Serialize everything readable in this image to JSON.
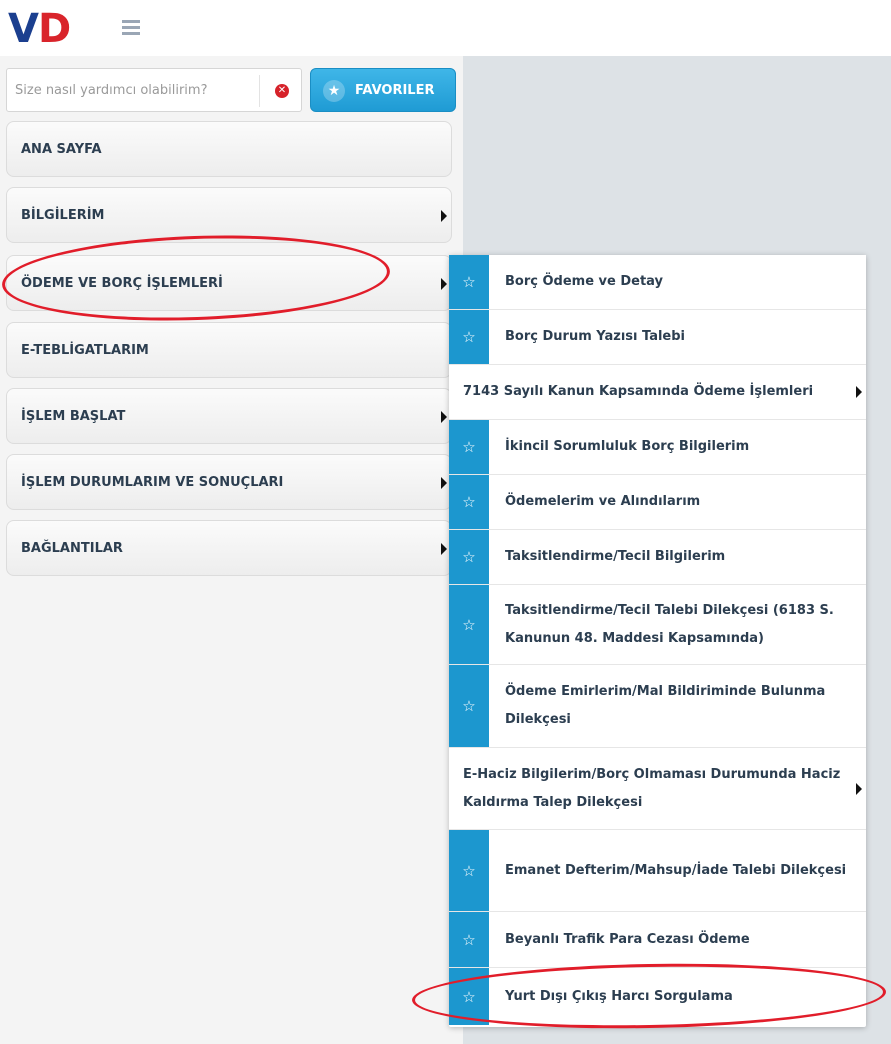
{
  "header": {
    "logo_v": "V",
    "logo_d": "D"
  },
  "search": {
    "placeholder": "Size nasıl yardımcı olabilirim?",
    "value": ""
  },
  "favorites": {
    "label": "FAVORILER"
  },
  "nav": {
    "items": [
      {
        "label": "ANA SAYFA",
        "has_arrow": false
      },
      {
        "label": "BİLGİLERİM",
        "has_arrow": true
      },
      {
        "label": "ÖDEME VE BORÇ İŞLEMLERİ",
        "has_arrow": true
      },
      {
        "label": "E-TEBLİGATLARIM",
        "has_arrow": false
      },
      {
        "label": "İŞLEM BAŞLAT",
        "has_arrow": true
      },
      {
        "label": "İŞLEM DURUMLARIM VE SONUÇLARI",
        "has_arrow": true
      },
      {
        "label": "BAĞLANTILAR",
        "has_arrow": true
      }
    ]
  },
  "submenu": {
    "items": [
      {
        "label": "Borç Ödeme ve Detay",
        "icon": "star-icon"
      },
      {
        "label": "Borç Durum Yazısı Talebi",
        "icon": "star-icon"
      },
      {
        "label": "7143 Sayılı Kanun Kapsamında Ödeme İşlemleri",
        "icon": ""
      },
      {
        "label": "İkincil Sorumluluk Borç Bilgilerim",
        "icon": "star-icon"
      },
      {
        "label": "Ödemelerim ve Alındılarım",
        "icon": "star-icon"
      },
      {
        "label": "Taksitlendirme/Tecil Bilgilerim",
        "icon": "star-icon"
      },
      {
        "label": "Taksitlendirme/Tecil Talebi Dilekçesi (6183 S. Kanunun 48. Maddesi Kapsamında)",
        "icon": "star-icon"
      },
      {
        "label": "Ödeme Emirlerim/Mal Bildiriminde Bulunma Dilekçesi",
        "icon": "star-icon"
      },
      {
        "label": "E-Haciz Bilgilerim/Borç Olmaması Durumunda Haciz Kaldırma Talep Dilekçesi",
        "icon": ""
      },
      {
        "label": "Emanet Defterim/Mahsup/İade Talebi Dilekçesi",
        "icon": "star-icon"
      },
      {
        "label": "Beyanlı Trafik Para Cezası Ödeme",
        "icon": "star-icon"
      },
      {
        "label": "Yurt Dışı Çıkış Harcı Sorgulama",
        "icon": "star-icon"
      }
    ]
  },
  "colors": {
    "accent": "#1c97cf",
    "annotation": "#e11d2a",
    "logo_blue": "#1b3f8f",
    "logo_red": "#d9242b"
  }
}
